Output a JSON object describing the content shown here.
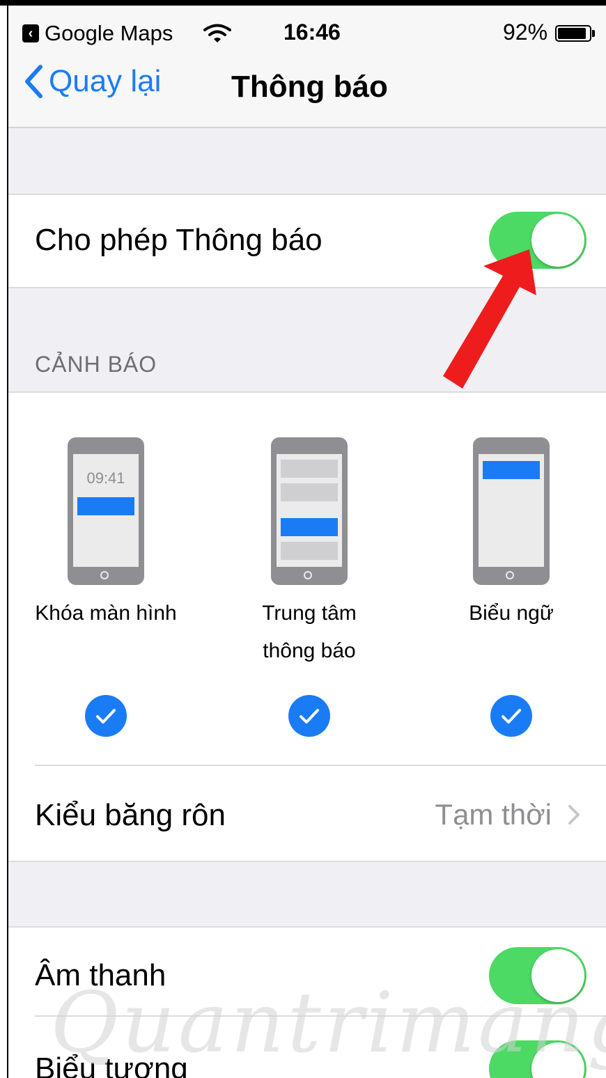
{
  "status_bar": {
    "back_app_label": "Google Maps",
    "time": "16:46",
    "battery_percent": "92%",
    "battery_level": 0.92
  },
  "nav": {
    "back_label": "Quay lại",
    "title": "Thông báo"
  },
  "allow_notifications": {
    "label": "Cho phép Thông báo",
    "enabled": true
  },
  "alerts": {
    "section_header": "CẢNH BÁO",
    "lock_screen": {
      "phone_time": "09:41",
      "label": "Khóa màn hình",
      "checked": true
    },
    "notification_center": {
      "label_line1": "Trung tâm",
      "label_line2": "thông báo",
      "checked": true
    },
    "banners": {
      "label": "Biểu ngữ",
      "checked": true
    }
  },
  "banner_style": {
    "label": "Kiểu băng rôn",
    "value": "Tạm thời"
  },
  "sounds": {
    "label": "Âm thanh",
    "enabled": true
  },
  "badges": {
    "label": "Biểu tượng",
    "enabled": true
  },
  "watermark": {
    "text": "Quantrimang"
  },
  "colors": {
    "accent": "#1a7cf5",
    "toggle_on": "#4cd964",
    "arrow": "#ee1c1c",
    "background": "#efeff4"
  }
}
